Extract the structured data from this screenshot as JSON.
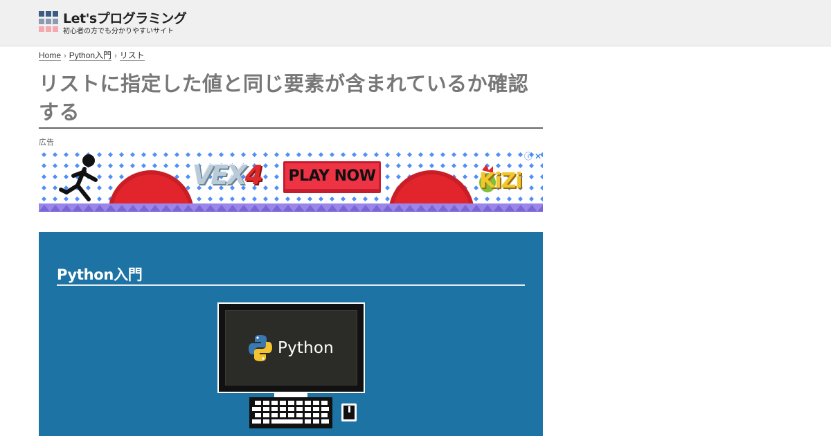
{
  "site": {
    "logo_title": "Let'sプログラミング",
    "logo_subtitle": "初心者の方でも分かりやすいサイト"
  },
  "breadcrumb": {
    "items": [
      "Home",
      "Python入門",
      "リスト"
    ],
    "separator": "›"
  },
  "article": {
    "title": "リストに指定した値と同じ要素が含まれているか確認する"
  },
  "ad": {
    "label": "広告",
    "vex_text": "VEX",
    "vex_number": "4",
    "play_button": "PLAY NOW",
    "kizi_text": "KiZi",
    "info_icon": "info-icon",
    "close_icon": "close-icon"
  },
  "feature": {
    "title": "Python入門",
    "screen_text": "Python",
    "background_color": "#1e73a5"
  },
  "colors": {
    "header_bg": "#f0f0f0",
    "title_text": "#777777",
    "ad_red": "#ee3344",
    "ad_purple": "#9a86e8"
  }
}
